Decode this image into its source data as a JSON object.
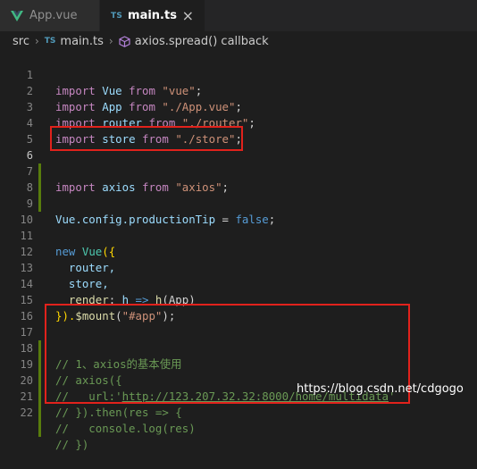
{
  "tabs": [
    {
      "label": "App.vue",
      "icon": "vue-icon",
      "active": false
    },
    {
      "label": "main.ts",
      "icon": "ts-icon",
      "badge": "TS",
      "active": true
    }
  ],
  "breadcrumb": {
    "folder": "src",
    "file": "main.ts",
    "file_badge": "TS",
    "symbol": "axios.spread() callback"
  },
  "lines": {
    "n1": "1",
    "n2": "2",
    "n3": "3",
    "n4": "4",
    "n5": "5",
    "n6": "6",
    "n7": "7",
    "n8": "8",
    "n9": "9",
    "n10": "10",
    "n11": "11",
    "n12": "12",
    "n13": "13",
    "n14": "14",
    "n15": "15",
    "n16": "16",
    "n17": "17",
    "n18": "18",
    "n19": "19",
    "n20": "20",
    "n21": "21",
    "n22": "22"
  },
  "code": {
    "import": "import",
    "from": "from",
    "l1_name": "Vue",
    "l1_src": "\"vue\"",
    "l2_name": "App",
    "l2_src": "\"./App.vue\"",
    "l3_name": "router",
    "l3_src": "\"./router\"",
    "l4_name": "store",
    "l4_src": "\"./store\"",
    "l6_name": "axios",
    "l6_src": "\"axios\"",
    "semi": ";",
    "l9_obj": "Vue",
    "l9_prop": ".config.productionTip",
    "l9_eq": " = ",
    "l9_val": "false",
    "l11_new": "new",
    "l11_cls": "Vue",
    "l11_open": "({",
    "l12": "router,",
    "l13": "store,",
    "l14_key": "render",
    "l14_rest_a": ": ",
    "l14_h": "h",
    "l14_arrow": " => ",
    "l14_call": "h",
    "l14_args": "(App)",
    "l15_close": "}).",
    "l15_fn": "$mount",
    "l15_open": "(",
    "l15_str": "\"#app\"",
    "l15_end": ");",
    "l17": "// 1、axios的基本使用",
    "l18": "// axios({",
    "l19_pre": "//   url:'",
    "l19_url": "http://123.207.32.32:8000/home/multidata",
    "l19_post": "'",
    "l20": "// }).then(res => {",
    "l21": "//   console.log(res)",
    "l22": "// })"
  },
  "watermark": "https://blog.csdn.net/cdgogo",
  "colors": {
    "editor_bg": "#1e1e1e",
    "keyword": "#569cd6",
    "import_keyword": "#c586c0",
    "string": "#ce9178",
    "comment": "#6a9955",
    "highlight_box": "#e1221c",
    "git_added": "#587c0c"
  }
}
